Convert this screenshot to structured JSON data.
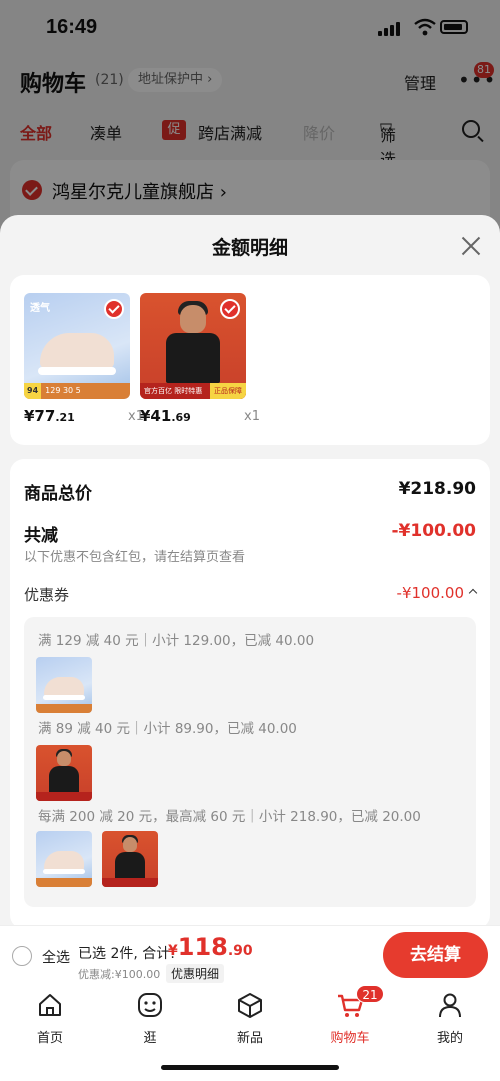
{
  "status_bar": {
    "time": "16:49"
  },
  "cart_header": {
    "title": "购物车",
    "count": "(21)",
    "address_protect": "地址保护中",
    "manage": "管理",
    "more_badge": "81"
  },
  "filters": {
    "all": "全部",
    "combo": "凑单",
    "promo_tag": "促",
    "cross_store": "跨店满减",
    "price_drop": "降价",
    "filter": "筛选"
  },
  "store": {
    "name": "鸿星尔克儿童旗舰店"
  },
  "sheet": {
    "title": "金额明细",
    "products": [
      {
        "price_int": "¥77",
        "price_dec": ".21",
        "qty": "x1",
        "label_small": "94",
        "band": "129  30  5"
      },
      {
        "price_int": "¥41",
        "price_dec": ".69",
        "qty": "x1",
        "band_left": "官方百亿 限时特惠",
        "band_right": "正品保障"
      }
    ],
    "total_label": "商品总价",
    "total_value": "¥218.90",
    "discount_label": "共减",
    "discount_value": "-¥100.00",
    "note": "以下优惠不包含红包，请在结算页查看",
    "coupon_label": "优惠券",
    "coupon_value": "-¥100.00",
    "coupon_rules": [
      "满 129 减 40 元｜小计 129.00，已减 40.00",
      "满 89 减 40 元｜小计 89.90，已减 40.00",
      "每满 200 减 20 元，最高减 60 元｜小计 218.90，已减 20.00"
    ]
  },
  "checkout": {
    "select_all": "全选",
    "selected_text": "已选 2件, 合计:",
    "price_symbol": "¥",
    "price_int": "118",
    "price_dec": ".90",
    "discount_text": "优惠减:¥100.00",
    "detail_link": "优惠明细",
    "button": "去结算"
  },
  "tabs": [
    {
      "label": "首页",
      "icon": "home-icon"
    },
    {
      "label": "逛",
      "icon": "browse-icon"
    },
    {
      "label": "新品",
      "icon": "box-icon"
    },
    {
      "label": "购物车",
      "icon": "cart-icon",
      "badge": "21",
      "active": true
    },
    {
      "label": "我的",
      "icon": "profile-icon"
    }
  ],
  "colors": {
    "accent": "#e0312b",
    "button": "#e63b2e"
  }
}
